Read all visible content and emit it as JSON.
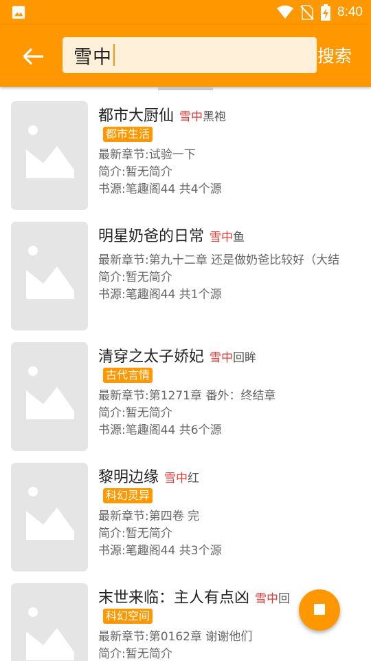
{
  "statusbar": {
    "time": "8:40",
    "icons": [
      "image-icon",
      "wifi-icon",
      "no-sim-icon",
      "battery-charging-icon"
    ]
  },
  "toolbar": {
    "search_value": "雪中",
    "search_button": "搜索",
    "back_icon": "arrow-left-icon"
  },
  "books": [
    {
      "title": "都市大厨仙",
      "author_highlight": "雪中",
      "author_rest": "黑袍",
      "tag": "都市生活",
      "latest": "最新章节:试验一下",
      "intro": "简介:暂无简介",
      "source": "书源:笔趣阁44 共4个源"
    },
    {
      "title": "明星奶爸的日常",
      "author_highlight": "雪中",
      "author_rest": "鱼",
      "tag": "",
      "latest": "最新章节:第九十二章 还是做奶爸比较好（大结",
      "intro": "简介:暂无简介",
      "source": "书源:笔趣阁44 共1个源"
    },
    {
      "title": "清穿之太子娇妃",
      "author_highlight": "雪中",
      "author_rest": "回眸",
      "tag": "古代言情",
      "latest": "最新章节:第1271章 番外：终结章",
      "intro": "简介:暂无简介",
      "source": "书源:笔趣阁44 共6个源"
    },
    {
      "title": "黎明边缘",
      "author_highlight": "雪中",
      "author_rest": "红",
      "tag": "科幻灵异",
      "latest": "最新章节:第四卷 完",
      "intro": "简介:暂无简介",
      "source": "书源:笔趣阁44 共3个源"
    },
    {
      "title": "末世来临：主人有点凶",
      "author_highlight": "雪中",
      "author_rest": "回",
      "tag": "科幻空间",
      "latest": "最新章节:第0162章 谢谢他们",
      "intro": "简介:暂无简介",
      "source": ""
    }
  ],
  "colors": {
    "accent": "#FF9800",
    "highlight": "#E53935",
    "placeholder": "#E5E5E5"
  }
}
